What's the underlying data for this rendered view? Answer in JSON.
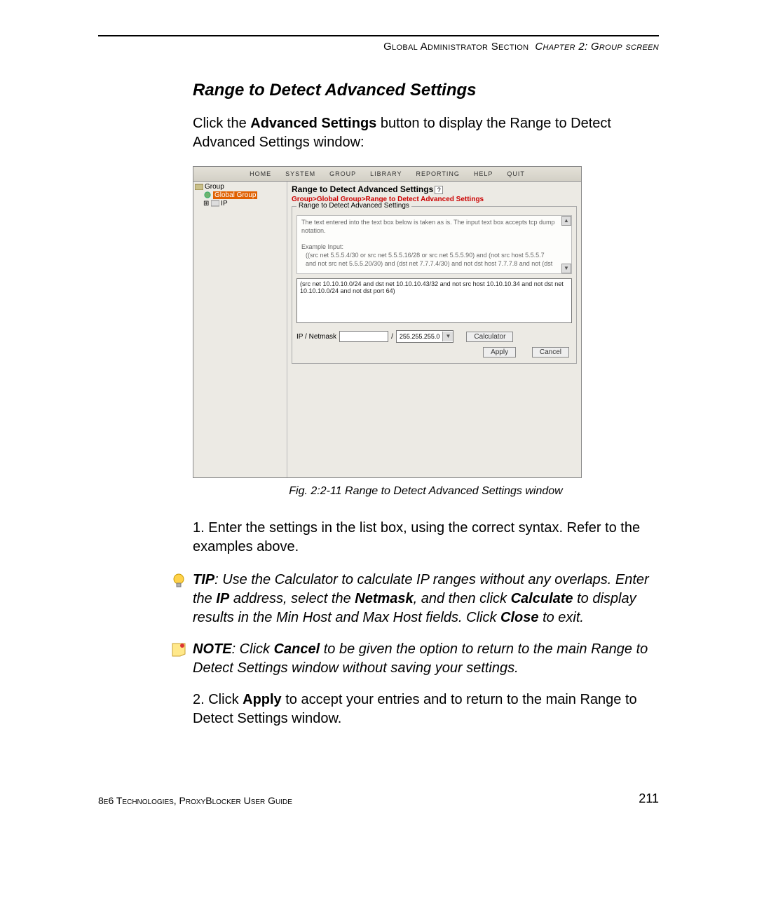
{
  "header": {
    "section": "Global Administrator Section",
    "chapter": "Chapter 2: Group screen"
  },
  "h2": "Range to Detect Advanced Settings",
  "intro_pre": "Click the ",
  "intro_bold": "Advanced Settings",
  "intro_post": " button to display the Range to Detect Advanced Settings window:",
  "screenshot": {
    "menu": [
      "HOME",
      "SYSTEM",
      "GROUP",
      "LIBRARY",
      "REPORTING",
      "HELP",
      "QUIT"
    ],
    "tree": {
      "root": "Group",
      "selected": "Global Group",
      "ip": "IP"
    },
    "panel_title": "Range to Detect Advanced Settings",
    "breadcrumb": "Group>Global Group>Range to Detect Advanced Settings",
    "fieldset_legend": "Range to Detect Advanced Settings",
    "help_l1": "The text entered into the text box below is taken as is. The input text box accepts tcp dump notation.",
    "help_l2": "Example Input:",
    "help_l3": "((src net 5.5.5.4/30 or src net 5.5.5.16/28 or src net 5.5.5.90) and (not src host 5.5.5.7",
    "help_l4": "and not src net 5.5.5.20/30) and (dst net 7.7.7.4/30) and not dst host 7.7.7.8 and not (dst",
    "input_text": "(src net 10.10.10.0/24 and dst net 10.10.10.43/32 and not src host 10.10.10.34 and not dst net 10.10.10.0/24 and not dst port 64)",
    "ip_label": "IP / Netmask",
    "slash": "/",
    "netmask_value": "255.255.255.0",
    "calc_label": "Calculator",
    "apply_label": "Apply",
    "cancel_label": "Cancel"
  },
  "caption": "Fig. 2:2-11  Range to Detect Advanced Settings window",
  "step1": "1.  Enter the settings in the list box, using the correct syntax. Refer to the examples above.",
  "tip": {
    "label": "TIP",
    "l1_pre": ": Use the Calculator to calculate IP ranges without any over­laps. Enter the ",
    "ip": "IP",
    "l1_mid": " address, select the ",
    "netmask": "Netmask",
    "l1_post": ", and then click ",
    "calc": "Calculate",
    "l2": " to display results in the Min Host and Max Host fields. Click ",
    "close": "Close",
    "l3": " to exit."
  },
  "note": {
    "label": "NOTE",
    "pre": ": Click ",
    "cancel": "Cancel",
    "post": " to be given the option to return to the main Range to Detect Settings window without saving your settings."
  },
  "step2_pre": "2.  Click ",
  "step2_b": "Apply",
  "step2_post": " to accept your entries and to return to the main Range to Detect Settings window.",
  "footer_left": "8e6 Technologies, ProxyBlocker User Guide",
  "footer_right": "211"
}
